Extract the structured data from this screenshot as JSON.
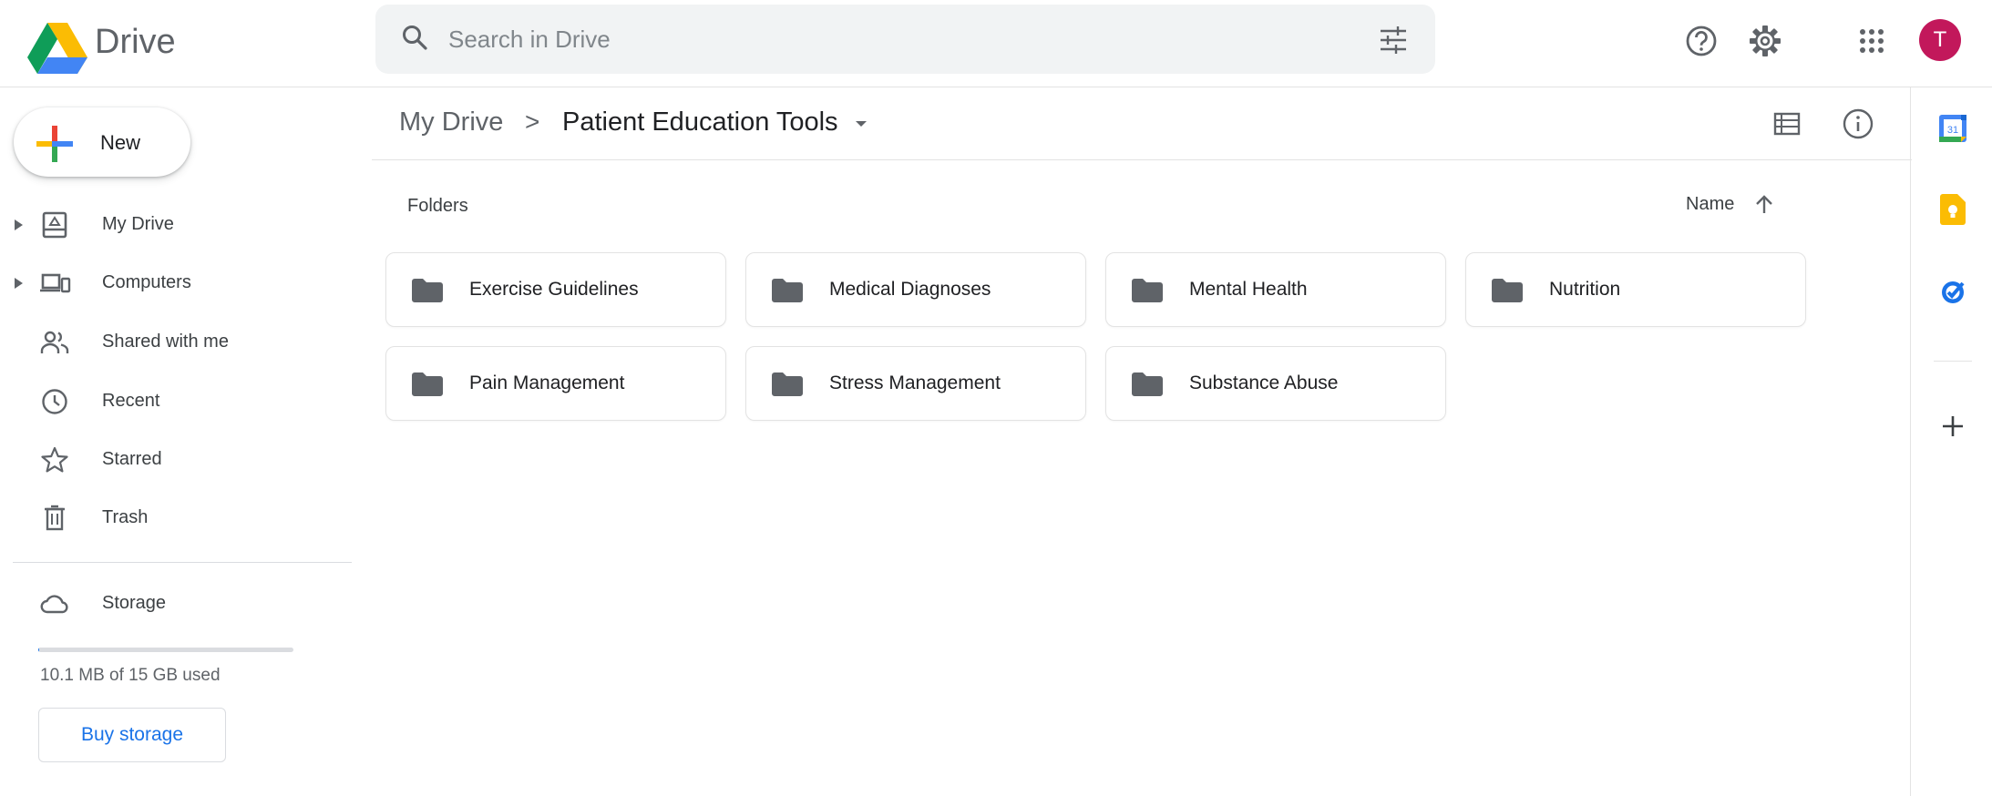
{
  "app": {
    "name": "Drive"
  },
  "search": {
    "placeholder": "Search in Drive"
  },
  "account": {
    "initial": "T",
    "avatar_color": "#c2185b"
  },
  "sidebar": {
    "new_label": "New",
    "items": [
      {
        "label": "My Drive",
        "icon": "my-drive-icon",
        "expandable": true
      },
      {
        "label": "Computers",
        "icon": "computers-icon",
        "expandable": true
      },
      {
        "label": "Shared with me",
        "icon": "shared-icon",
        "expandable": false
      },
      {
        "label": "Recent",
        "icon": "clock-icon",
        "expandable": false
      },
      {
        "label": "Starred",
        "icon": "star-icon",
        "expandable": false
      },
      {
        "label": "Trash",
        "icon": "trash-icon",
        "expandable": false
      }
    ],
    "storage": {
      "label": "Storage",
      "usage_text": "10.1 MB of 15 GB used",
      "used_fraction": 0.0007,
      "buy_label": "Buy storage"
    }
  },
  "breadcrumb": {
    "root": "My Drive",
    "separator": ">",
    "current": "Patient Education Tools"
  },
  "content": {
    "section_label": "Folders",
    "sort_label": "Name",
    "sort_direction": "ascending",
    "folders": [
      "Exercise Guidelines",
      "Medical Diagnoses",
      "Mental Health",
      "Nutrition",
      "Pain Management",
      "Stress Management",
      "Substance Abuse"
    ]
  },
  "side_panel": {
    "apps": [
      "calendar-icon",
      "keep-icon",
      "tasks-icon",
      "add-icon"
    ]
  },
  "colors": {
    "accent": "#1a73e8",
    "text": "#3c4043",
    "folder_icon": "#5f6368",
    "search_bg": "#f1f3f4"
  }
}
